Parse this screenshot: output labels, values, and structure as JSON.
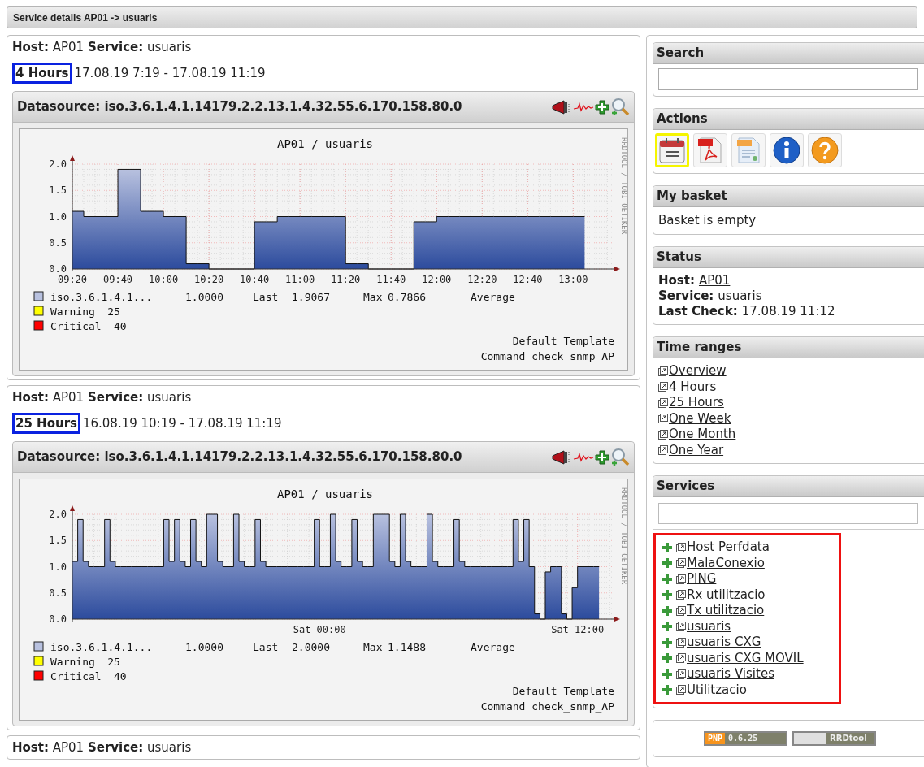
{
  "title_bar": "Service details AP01 -> usuaris",
  "sections": [
    {
      "host_line": "**Host:** AP01 **Service:** usuaris",
      "range": {
        "label": "4 Hours",
        "highlighted": true
      },
      "dates": "17.08.19 7:19 - 17.08.19 11:19",
      "graph": {
        "datasource": "Datasource: iso.3.6.1.4.1.14179.2.2.13.1.4.32.55.6.170.158.80.0",
        "side_label": "RRDTOOL / TOBI OETIKER",
        "chart_data": {
          "type": "area",
          "title": "AP01 / usuaris",
          "grid": true,
          "ylim": [
            0,
            2.0
          ],
          "categories": [
            "09:20",
            null,
            null,
            null,
            "09:40",
            null,
            null,
            null,
            "10:00",
            null,
            null,
            null,
            "10:20",
            null,
            null,
            null,
            "10:40",
            null,
            null,
            null,
            "11:00",
            null,
            null,
            null,
            "11:20",
            null,
            null,
            null,
            "11:40",
            null,
            null,
            null,
            "12:00",
            null,
            null,
            null,
            "12:20",
            null,
            null,
            null,
            "12:40",
            null,
            null,
            null,
            "13:00",
            null
          ],
          "series": [
            {
              "name": "iso.3.6.1.4.1...",
              "color": "#b8c1df",
              "values": [
                1.1,
                1.0,
                1.0,
                1.0,
                1.9,
                1.9,
                1.1,
                1.1,
                1.0,
                1.0,
                0.1,
                0.1,
                0,
                0,
                0,
                0,
                0.9,
                0.9,
                1.0,
                1.0,
                1.0,
                1.0,
                1.0,
                1.0,
                0.1,
                0.1,
                0,
                0,
                0,
                0,
                0.9,
                0.9,
                1.0,
                1.0,
                1.0,
                1.0,
                1.0,
                1.0,
                1.0,
                1.0,
                1.0,
                1.0,
                1.0,
                1.0,
                1.0,
                1.0
              ]
            }
          ],
          "yticks": [
            {
              "value": 0,
              "label": "0.0"
            },
            {
              "value": 0.5,
              "label": "0.5"
            },
            {
              "value": 1,
              "label": "1.0"
            },
            {
              "value": 1.5,
              "label": "1.5"
            },
            {
              "value": 2,
              "label": "2.0"
            }
          ]
        },
        "legend": [
          {
            "color": "#b8c1df",
            "texts": [
              "1.0000",
              "Last",
              "1.9067",
              "Max",
              "0.7866",
              "Average"
            ]
          },
          {
            "color": "#ffff00",
            "texts": [
              "Warning",
              "25"
            ]
          },
          {
            "color": "#ff0000",
            "texts": [
              "Critical",
              "40"
            ]
          }
        ],
        "template": "Default Template",
        "command": "Command check_snmp_AP"
      }
    },
    {
      "host_line": "**Host:** AP01 **Service:** usuaris",
      "range": {
        "label": "25 Hours",
        "highlighted": true
      },
      "dates": "16.08.19 10:19 - 17.08.19 11:19",
      "graph": {
        "datasource": "Datasource: iso.3.6.1.4.1.14179.2.2.13.1.4.32.55.6.170.158.80.0",
        "side_label": "RRDTOOL / TOBI OETIKER",
        "chart_data": {
          "type": "area",
          "title": "AP01 / usuaris",
          "grid": true,
          "ylim": [
            0,
            2.0
          ],
          "categories": [
            null,
            null,
            null,
            null,
            null,
            null,
            null,
            null,
            null,
            null,
            null,
            null,
            null,
            null,
            null,
            null,
            null,
            null,
            null,
            null,
            null,
            null,
            null,
            null,
            null,
            null,
            null,
            null,
            null,
            null,
            null,
            null,
            null,
            null,
            null,
            null,
            null,
            null,
            null,
            null,
            null,
            null,
            null,
            null,
            null,
            null,
            "Sat 00:00",
            null,
            null,
            null,
            null,
            null,
            null,
            null,
            null,
            null,
            null,
            null,
            null,
            null,
            null,
            null,
            null,
            null,
            null,
            null,
            null,
            null,
            null,
            null,
            null,
            null,
            null,
            null,
            null,
            null,
            null,
            null,
            null,
            null,
            null,
            null,
            null,
            null,
            null,
            null,
            null,
            null,
            null,
            null,
            null,
            null,
            null,
            null,
            "Sat 12:00",
            null,
            null,
            null,
            null
          ],
          "series": [
            {
              "name": "iso.3.6.1.4.1...",
              "color": "#b8c1df",
              "values": [
                1.1,
                1.9,
                1.1,
                1.0,
                1.0,
                1.0,
                1.9,
                1.1,
                1.0,
                1.0,
                1.0,
                1.0,
                1.0,
                1.0,
                1.0,
                1.0,
                1.0,
                1.9,
                1.1,
                1.9,
                1.1,
                1.0,
                1.9,
                1.1,
                1.0,
                2.0,
                2.0,
                1.1,
                1.0,
                1.0,
                2.0,
                1.1,
                1.0,
                1.0,
                1.9,
                1.1,
                1.0,
                1.0,
                1.0,
                1.0,
                1.0,
                1.0,
                1.0,
                1.0,
                1.0,
                1.9,
                1.0,
                1.0,
                2.0,
                1.1,
                1.0,
                1.0,
                1.9,
                1.1,
                1.0,
                1.0,
                2.0,
                2.0,
                2.0,
                1.1,
                1.0,
                2.0,
                1.1,
                1.0,
                1.0,
                1.0,
                2.0,
                1.1,
                1.0,
                1.0,
                1.0,
                1.9,
                1.1,
                1.0,
                1.0,
                1.0,
                1.0,
                1.0,
                1.0,
                1.0,
                1.0,
                1.0,
                1.9,
                1.1,
                1.9,
                1.0,
                0.1,
                0,
                0.9,
                1.0,
                1.0,
                0.1,
                0,
                0.6,
                1.0,
                1.0,
                1.0,
                1.0,
                1.0
              ]
            }
          ],
          "yticks": [
            {
              "value": 0,
              "label": "0.0"
            },
            {
              "value": 0.5,
              "label": "0.5"
            },
            {
              "value": 1,
              "label": "1.0"
            },
            {
              "value": 1.5,
              "label": "1.5"
            },
            {
              "value": 2,
              "label": "2.0"
            }
          ]
        },
        "legend": [
          {
            "color": "#b8c1df",
            "texts": [
              "1.0000",
              "Last",
              "2.0000",
              "Max",
              "1.1488",
              "Average"
            ]
          },
          {
            "color": "#ffff00",
            "texts": [
              "Warning",
              "25"
            ]
          },
          {
            "color": "#ff0000",
            "texts": [
              "Critical",
              "40"
            ]
          }
        ],
        "template": "Default Template",
        "command": "Command check_snmp_AP"
      }
    },
    {
      "host_line": "**Host:** AP01 **Service:** usuaris"
    }
  ],
  "sidebar": {
    "search": {
      "title": "Search"
    },
    "actions": {
      "title": "Actions",
      "items": [
        {
          "kind": "calendar",
          "highlighted": true
        },
        {
          "kind": "pdf",
          "highlighted": false
        },
        {
          "kind": "xml",
          "highlighted": false
        },
        {
          "kind": "info",
          "highlighted": false
        },
        {
          "kind": "help",
          "highlighted": false
        }
      ]
    },
    "basket": {
      "title": "My basket",
      "text": "Basket is empty"
    },
    "status": {
      "title": "Status",
      "lines": [
        {
          "label": "Host:",
          "value": "AP01",
          "link": true
        },
        {
          "label": "Service:",
          "value": "usuaris",
          "link": true
        },
        {
          "label": "Last Check:",
          "value": "17.08.19 11:12",
          "link": false
        }
      ]
    },
    "time_ranges": {
      "title": "Time ranges",
      "items": [
        "Overview",
        "4 Hours",
        "25 Hours",
        "One Week",
        "One Month",
        "One Year"
      ]
    },
    "services": {
      "title": "Services",
      "highlighted": true,
      "items": [
        "Host Perfdata",
        "MalaConexio",
        "PING",
        "Rx utilitzacio",
        "Tx utilitzacio",
        "usuaris",
        "usuaris CXG",
        "usuaris CXG MOVIL",
        "usuaris Visites",
        "Utilitzacio"
      ]
    },
    "badges": [
      {
        "label": "PNP",
        "version": "0.6.25"
      },
      {
        "label": "RRDtool"
      }
    ]
  }
}
